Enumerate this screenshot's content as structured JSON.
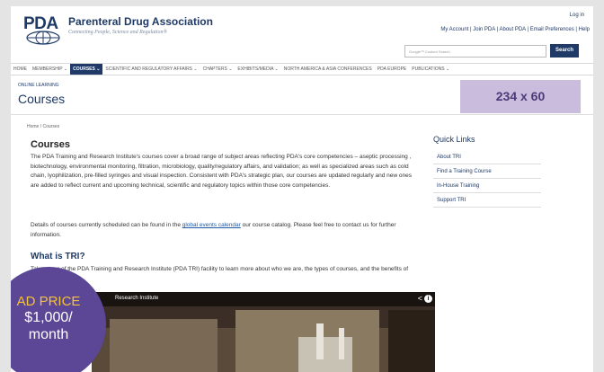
{
  "header": {
    "logo_text": "PDA",
    "org_name": "Parenteral Drug Association",
    "tagline": "Connecting People, Science and Regulation®",
    "login": "Log in",
    "util_links": "My Account | Join PDA | About PDA | Email Preferences | Help",
    "search_placeholder": "Google™ Custom Search",
    "search_button": "Search"
  },
  "nav": {
    "items": [
      "HOME",
      "MEMBERSHIP ⌄",
      "COURSES ⌄",
      "SCIENTIFIC AND REGULATORY AFFAIRS ⌄",
      "CHAPTERS ⌄",
      "EXHIBITS/MEDIA ⌄",
      "NORTH AMERICA & ASIA CONFERENCES",
      "PDA EUROPE",
      "PUBLICATIONS ⌄"
    ]
  },
  "section": {
    "label": "ONLINE LEARNING",
    "title": "Courses"
  },
  "ad_box": "234 x 60",
  "breadcrumb": "Home  /  Courses",
  "content": {
    "title": "Courses",
    "p1": "The PDA Training and Research Institute's courses cover a broad range of subject areas reflecting PDA's core competencies – aseptic processing , biotechnology, environmental monitoring, filtration, microbiology, quality/regulatory affairs, and validation; as well as specialized areas such as cold chain, lyophilization, pre-filled syringes and visual inspection. Consistent with PDA's strategic plan, our courses are updated regularly and new ones are added to reflect current and upcoming technical, scientific and regulatory topics within those core competencies.",
    "p2_before": "Details of courses currently scheduled can be found in the ",
    "p2_link": "global events calendar",
    "p2_after": " our course catalog. Please feel free to contact us for further information.",
    "what_title": "What is TRI?",
    "p3": "Take a tour of the PDA Training and Research Institute (PDA TRI) facility to learn more about who we are, the types of courses, and the benefits of TRI courses."
  },
  "video": {
    "title": "Research Institute",
    "share": "<",
    "info": "i"
  },
  "quick_links": {
    "title": "Quick Links",
    "items": [
      "About TRI",
      "Find a Training Course",
      "In-House Training",
      "Support TRI"
    ]
  },
  "ad_badge": {
    "line1": "AD PRICE",
    "line2": "$1,000/",
    "line3": "month"
  },
  "colors": {
    "brand": "#1f3a66",
    "ad_purple": "#5c4696",
    "ad_box": "#c9bcdd"
  }
}
